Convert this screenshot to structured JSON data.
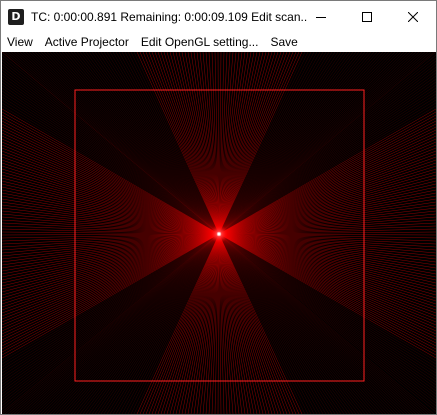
{
  "window": {
    "title": "TC: 0:00:00.891  Remaining: 0:00:09.109  Edit scan...",
    "app_icon_letter": "D"
  },
  "menu": {
    "items": [
      "View",
      "Active Projector",
      "Edit OpenGL setting...",
      "Save"
    ]
  },
  "colors": {
    "laser": "#ff0000",
    "canvas_bg": "#000000"
  }
}
